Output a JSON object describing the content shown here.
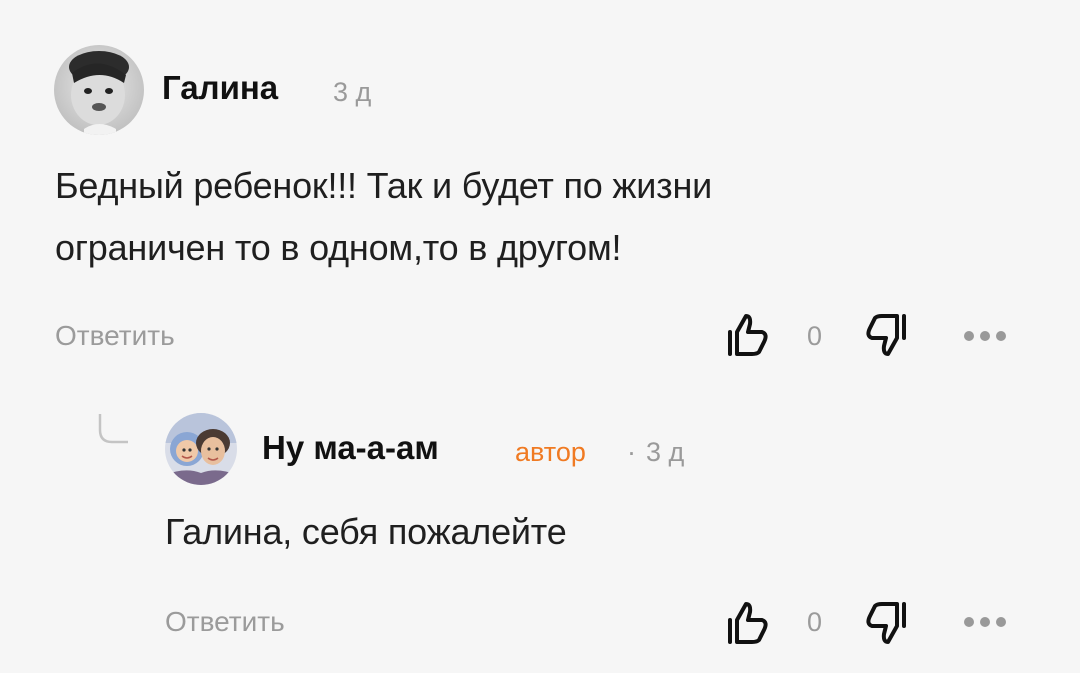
{
  "comments": [
    {
      "author": "Галина",
      "time": "3 д",
      "text_line1": "Бедный ребенок!!! Так и будет по жизни",
      "text_line2": "ограничен то в одном,то в другом!",
      "reply_label": "Ответить",
      "like_count": "0",
      "avatar_icon": "baby-photo-avatar"
    }
  ],
  "reply": {
    "author": "Ну ма-а-ам",
    "author_badge": "автор",
    "separator": "·",
    "time": "3 д",
    "text": "Галина, себя пожалейте",
    "reply_label": "Ответить",
    "like_count": "0",
    "avatar_icon": "mother-child-photo-avatar"
  },
  "icons": {
    "like": "thumbs-up-icon",
    "dislike": "thumbs-down-icon",
    "more": "more-dots-icon",
    "thread": "reply-thread-line-icon"
  },
  "colors": {
    "background": "#f6f6f6",
    "author_badge": "#f07a22",
    "muted": "#9b9b9b",
    "text": "#1f1f1f"
  }
}
